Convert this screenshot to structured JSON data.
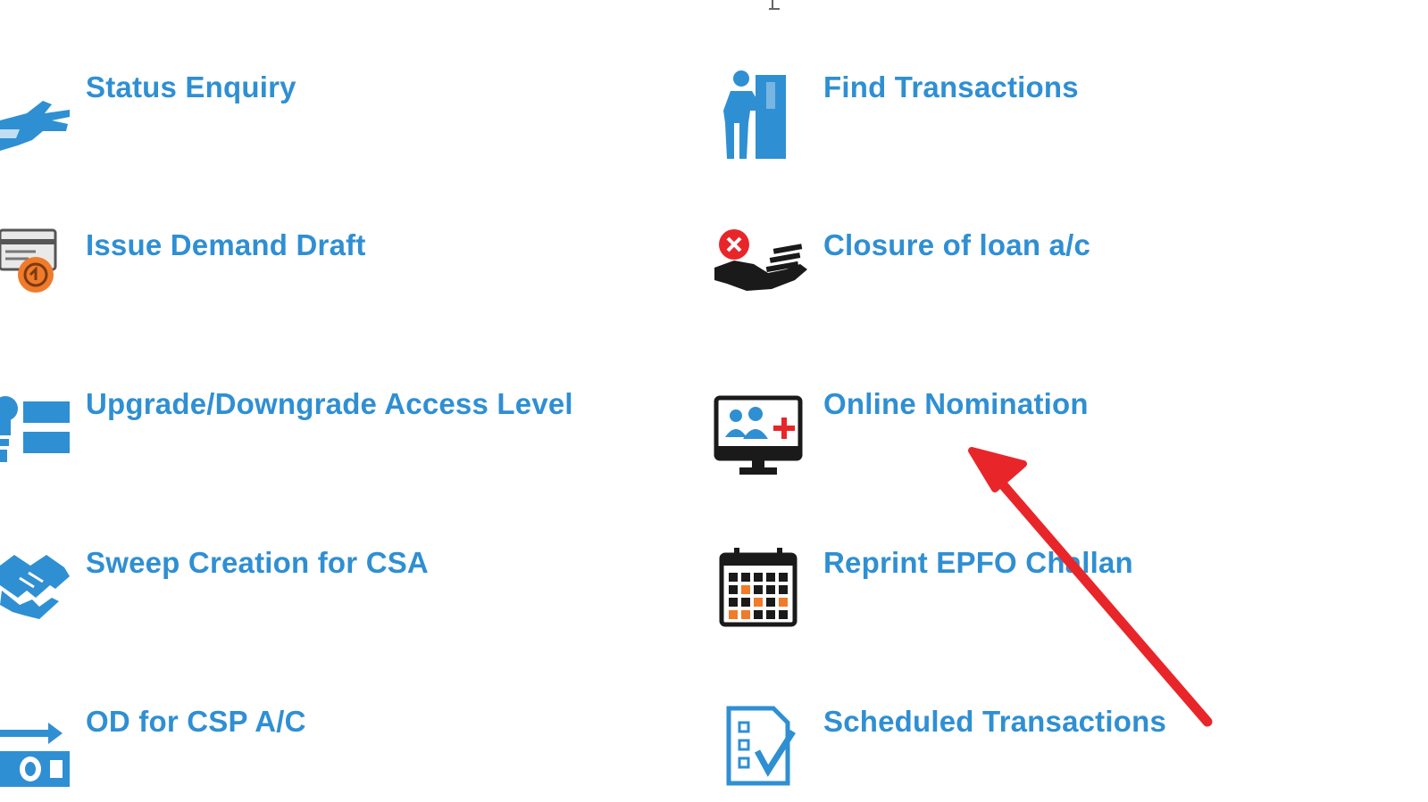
{
  "colors": {
    "link": "#2f8fd3",
    "icon_blue": "#2f8fd3",
    "icon_dark": "#1a1a1a",
    "accent_red": "#e8262a",
    "accent_orange": "#f07b2a"
  },
  "menu": {
    "left": [
      {
        "label": "Status Enquiry",
        "icon": "hand-pointing-icon"
      },
      {
        "label": "Issue Demand Draft",
        "icon": "demand-draft-icon"
      },
      {
        "label": "Upgrade/Downgrade Access Level",
        "icon": "access-level-icon"
      },
      {
        "label": "Sweep Creation for CSA",
        "icon": "handshake-icon"
      },
      {
        "label": "OD for CSP A/C",
        "icon": "banknote-arrow-icon"
      }
    ],
    "right": [
      {
        "label": "Find Transactions",
        "icon": "person-at-door-icon"
      },
      {
        "label": "Closure of loan a/c",
        "icon": "cancel-cash-hand-icon"
      },
      {
        "label": "Online Nomination",
        "icon": "monitor-users-plus-icon"
      },
      {
        "label": "Reprint EPFO Challan",
        "icon": "calendar-icon"
      },
      {
        "label": "Scheduled Transactions",
        "icon": "checklist-icon"
      }
    ]
  }
}
